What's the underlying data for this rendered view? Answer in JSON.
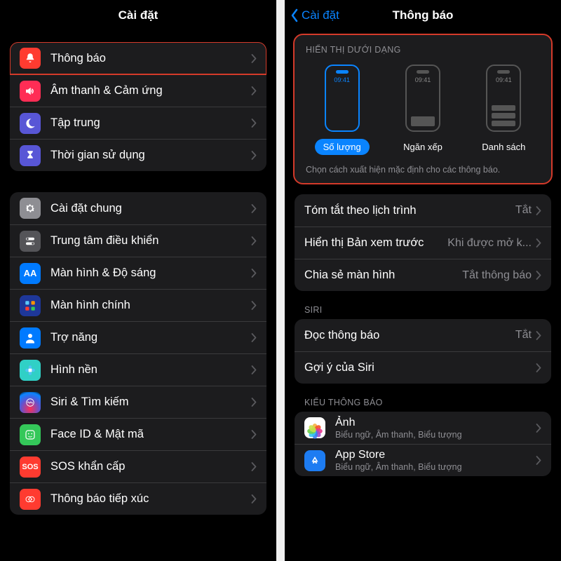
{
  "left": {
    "title": "Cài đặt",
    "group1": [
      {
        "label": "Thông báo",
        "icon": "bell",
        "bg": "bg-red",
        "highlight": true
      },
      {
        "label": "Âm thanh & Cảm ứng",
        "icon": "speaker",
        "bg": "bg-pink"
      },
      {
        "label": "Tập trung",
        "icon": "moon",
        "bg": "bg-indigo"
      },
      {
        "label": "Thời gian sử dụng",
        "icon": "hourglass",
        "bg": "bg-indigo"
      }
    ],
    "group2": [
      {
        "label": "Cài đặt chung",
        "icon": "gear",
        "bg": "bg-gray"
      },
      {
        "label": "Trung tâm điều khiển",
        "icon": "switches",
        "bg": "bg-graydark"
      },
      {
        "label": "Màn hình & Độ sáng",
        "icon": "AA",
        "bg": "bg-blue"
      },
      {
        "label": "Màn hình chính",
        "icon": "grid",
        "bg": "bg-darkblue"
      },
      {
        "label": "Trợ năng",
        "icon": "person",
        "bg": "bg-blue"
      },
      {
        "label": "Hình nền",
        "icon": "flower-bg",
        "bg": "bg-teal"
      },
      {
        "label": "Siri & Tìm kiếm",
        "icon": "siri",
        "bg": "bg-siri"
      },
      {
        "label": "Face ID & Mật mã",
        "icon": "face",
        "bg": "bg-green"
      },
      {
        "label": "SOS khẩn cấp",
        "icon": "SOS",
        "bg": "bg-red"
      },
      {
        "label": "Thông báo tiếp xúc",
        "icon": "exposure",
        "bg": "bg-red"
      }
    ]
  },
  "right": {
    "back": "Cài đặt",
    "title": "Thông báo",
    "display_as": {
      "header": "HIỂN THỊ DƯỚI DẠNG",
      "time": "09:41",
      "options": [
        {
          "label": "Số lượng",
          "active": true,
          "bars": 0
        },
        {
          "label": "Ngăn xếp",
          "active": false,
          "bars": 1
        },
        {
          "label": "Danh sách",
          "active": false,
          "bars": 3
        }
      ],
      "footer": "Chọn cách xuất hiện mặc định cho các thông báo."
    },
    "options": [
      {
        "label": "Tóm tắt theo lịch trình",
        "value": "Tắt"
      },
      {
        "label": "Hiển thị Bản xem trước",
        "value": "Khi được mở k..."
      },
      {
        "label": "Chia sẻ màn hình",
        "value": "Tắt thông báo"
      }
    ],
    "siri_header": "SIRI",
    "siri": [
      {
        "label": "Đọc thông báo",
        "value": "Tắt"
      },
      {
        "label": "Gợi ý của Siri",
        "value": ""
      }
    ],
    "style_header": "KIỂU THÔNG BÁO",
    "apps": [
      {
        "label": "Ảnh",
        "sub": "Biểu ngữ, Âm thanh, Biểu tượng",
        "icon": "photos"
      },
      {
        "label": "App Store",
        "sub": "Biểu ngữ, Âm thanh, Biểu tượng",
        "icon": "appstore"
      }
    ]
  }
}
